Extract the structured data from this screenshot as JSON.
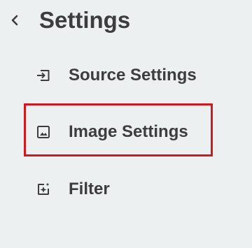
{
  "header": {
    "back_icon": "chevron-left-icon",
    "title": "Settings"
  },
  "menu": {
    "items": [
      {
        "label": "Source Settings",
        "icon": "input-arrow-icon"
      },
      {
        "label": "Image Settings",
        "icon": "image-icon",
        "highlighted": true
      },
      {
        "label": "Filter",
        "icon": "sparkle-filter-icon"
      }
    ]
  },
  "colors": {
    "background": "#ecf0f1",
    "text": "#3d3d3d",
    "highlight_border": "#d0191f"
  }
}
